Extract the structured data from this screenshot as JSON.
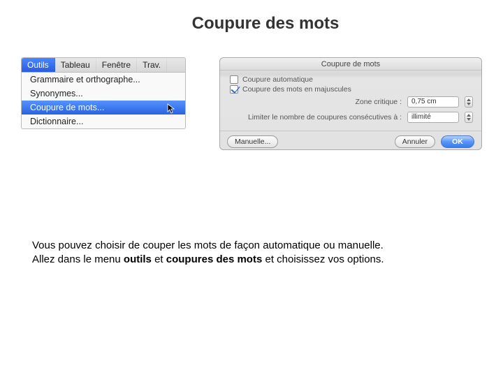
{
  "title": "Coupure des mots",
  "menu": {
    "bar": [
      "Outils",
      "Tableau",
      "Fenêtre",
      "Trav."
    ],
    "active_index": 0,
    "items": [
      {
        "label": "Grammaire et orthographe...",
        "highlight": false
      },
      {
        "label": "Synonymes...",
        "highlight": false
      },
      {
        "label": "Coupure de mots...",
        "highlight": true
      },
      {
        "label": "Dictionnaire...",
        "highlight": false
      }
    ]
  },
  "dialog": {
    "title": "Coupure de mots",
    "check_auto": {
      "label": "Coupure automatique",
      "checked": false
    },
    "check_caps": {
      "label": "Coupure des mots en majuscules",
      "checked": true
    },
    "zone": {
      "label": "Zone critique :",
      "value": "0,75 cm"
    },
    "limit": {
      "label": "Limiter le nombre de coupures consécutives à :",
      "value": "illimité"
    },
    "buttons": {
      "manual": "Manuelle...",
      "cancel": "Annuler",
      "ok": "OK"
    }
  },
  "caption": {
    "p1a": "Vous pouvez choisir de couper les mots de façon automatique ou manuelle.",
    "p2a": "Allez dans le menu ",
    "p2b": "outils",
    "p2c": " et ",
    "p2d": "coupures des mots",
    "p2e": " et choisissez vos options."
  }
}
